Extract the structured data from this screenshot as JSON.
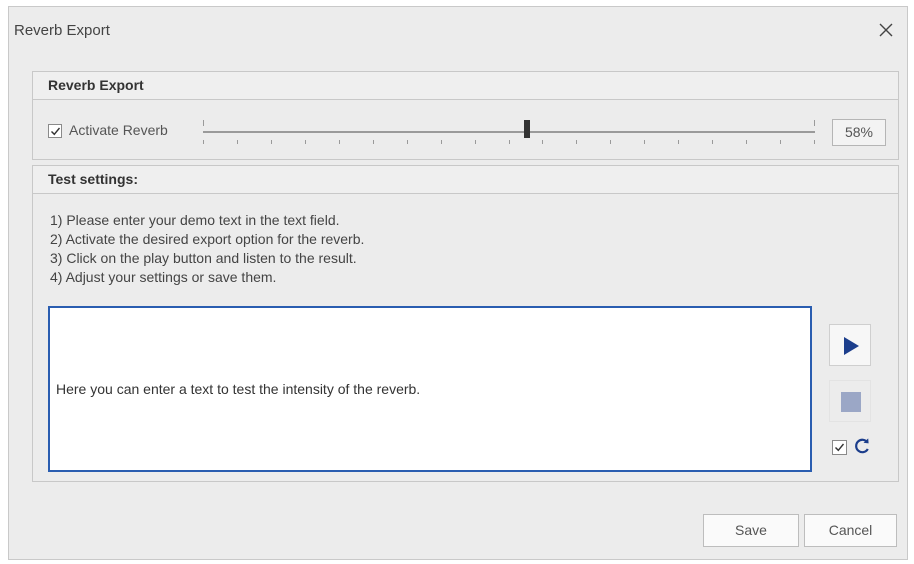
{
  "window": {
    "title": "Reverb Export",
    "close_icon": "close-icon"
  },
  "reverb_group": {
    "header": "Reverb Export",
    "activate_label": "Activate Reverb",
    "activate_checked": true,
    "slider_value_fraction": 0.53,
    "percent_text": "58%"
  },
  "test_group": {
    "header": "Test settings:",
    "instructions": [
      "1) Please enter your demo text in the text field.",
      "2) Activate the desired export option for the reverb.",
      "3) Click on the play button and listen to the result.",
      "4) Adjust your settings or save them."
    ],
    "demo_text": "Here you can enter a text to test the intensity of the reverb.",
    "play_icon": "play-icon",
    "stop_icon": "stop-icon",
    "loop_checked": true,
    "loop_icon": "refresh-icon"
  },
  "buttons": {
    "save": "Save",
    "cancel": "Cancel"
  },
  "colors": {
    "accent": "#2a5db0",
    "play": "#1c3e8c",
    "stop_disabled": "#9ba7c6"
  }
}
